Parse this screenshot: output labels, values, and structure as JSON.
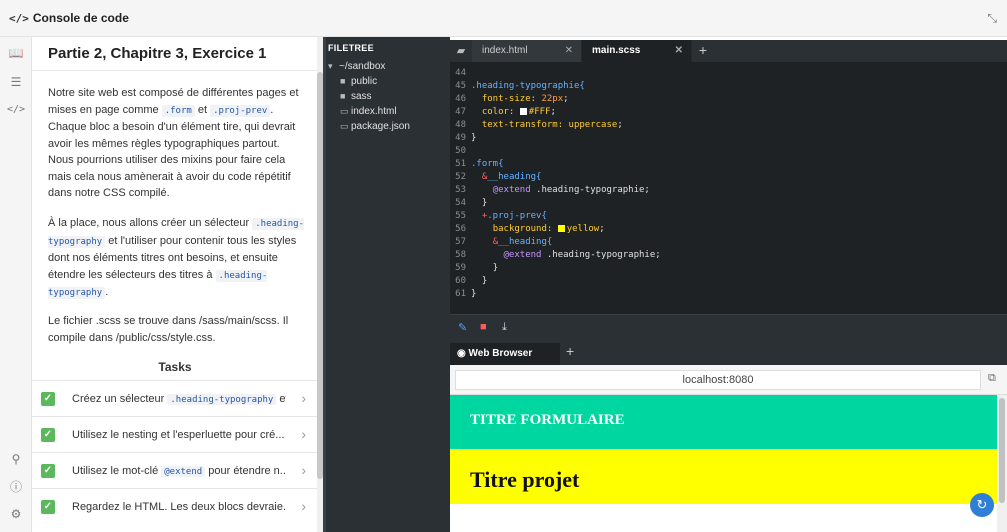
{
  "header": {
    "title": "Console de code",
    "code_icon": "</>",
    "collapse_icon": "collapse-icon"
  },
  "leftbar": {
    "icons": [
      "book-icon",
      "list-icon",
      "code-icon",
      "share-icon",
      "help-icon",
      "settings-icon"
    ]
  },
  "lesson": {
    "title": "Partie 2, Chapitre 3, Exercice 1",
    "p1_a": "Notre site web est composé de différentes pages et mises en page comme ",
    "p1_code1": ".form",
    "p1_b": " et ",
    "p1_code2": ".proj-prev",
    "p1_c": ". Chaque bloc a besoin d'un élément tire, qui devrait avoir les mêmes règles typographiques partout. Nous pourrions utiliser des mixins pour faire cela mais cela nous amènerait à avoir du code répétitif dans notre CSS compilé.",
    "p2_a": "À la place, nous allons créer un sélecteur ",
    "p2_code1": ".heading-typography",
    "p2_b": " et l'utiliser pour contenir tous les styles dont nos éléments titres ont besoins, et ensuite étendre les sélecteurs des titres à ",
    "p2_code2": ".heading-typography",
    "p2_c": ".",
    "p3": "Le fichier .scss se trouve dans /sass/main/scss. Il compile dans /public/css/style.css.",
    "tasks_title": "Tasks",
    "tasks": [
      {
        "a": "Créez un sélecteur ",
        "code": ".heading-typography",
        "b": " et..."
      },
      {
        "a": "Utilisez le nesting et l'esperluette pour cré...",
        "code": "",
        "b": ""
      },
      {
        "a": "Utilisez le mot-clé ",
        "code": "@extend",
        "b": " pour étendre n..."
      },
      {
        "a": "Regardez le HTML. Les deux blocs devraie...",
        "code": "",
        "b": ""
      }
    ]
  },
  "filetree": {
    "title": "FILETREE",
    "root": "~/sandbox",
    "items": [
      "public",
      "sass",
      "index.html",
      "package.json"
    ]
  },
  "editor": {
    "tabs": [
      {
        "label": "index.html"
      },
      {
        "label": "main.scss"
      }
    ],
    "lines": [
      "44",
      "45",
      "46",
      "47",
      "48",
      "49",
      "50",
      "51",
      "52",
      "53",
      "54",
      "55",
      "56",
      "57",
      "58",
      "59",
      "60",
      "61"
    ],
    "code": {
      "l45_sel": ".heading-typographie{",
      "l46_prop": "font-size:",
      "l46_val": "22px",
      "l47_prop": "color:",
      "l47_val": "#FFF",
      "l48_prop": "text-transform:",
      "l48_val": "uppercase",
      "l49": "}",
      "l51": ".form{",
      "l52_amp": "&",
      "l52": "__heading{",
      "l53_kw": "@extend",
      "l53": " .heading-typographie;",
      "l54": "}",
      "l55_amp": "+",
      "l55": ".proj-prev{",
      "l56_prop": "background:",
      "l56_val": "yellow",
      "l57_amp": "&",
      "l57": "__heading{",
      "l58_kw": "@extend",
      "l58": " .heading-typographie;",
      "l59": "}",
      "l60": "}",
      "l61": "}"
    },
    "toolbar": [
      "pencil-icon",
      "trash-icon",
      "download-icon"
    ]
  },
  "browser": {
    "tab": "Web Browser",
    "url": "localhost:8080",
    "heading1": "Titre formulaire",
    "heading2": "Titre projet",
    "colors": {
      "form_bg": "#00d7a0",
      "proj_bg": "#ffff00"
    }
  }
}
